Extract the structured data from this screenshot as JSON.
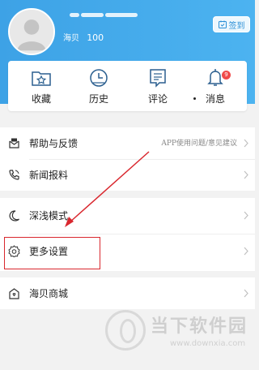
{
  "profile": {
    "username_hidden": true,
    "points_label": "海贝",
    "points_value": "100",
    "checkin_label": "签到"
  },
  "quick_actions": [
    {
      "label": "收藏",
      "icon": "folder-star-icon"
    },
    {
      "label": "历史",
      "icon": "clock-history-icon"
    },
    {
      "label": "评论",
      "icon": "comment-doc-icon"
    },
    {
      "label": "消息",
      "icon": "bell-icon",
      "badge": "9"
    }
  ],
  "menu": {
    "help": {
      "label": "帮助与反馈",
      "hint": "APP使用问题/意见建议"
    },
    "tips": {
      "label": "新闻报料"
    },
    "theme": {
      "label": "深浅模式"
    },
    "settings": {
      "label": "更多设置"
    },
    "store": {
      "label": "海贝商城"
    }
  },
  "watermark": {
    "text": "当下软件园",
    "url": "www.downxia.com"
  },
  "colors": {
    "header": "#3da2e6",
    "accent": "#2b8fd6",
    "annotation": "#d9272e",
    "badge": "#f04a4a"
  }
}
